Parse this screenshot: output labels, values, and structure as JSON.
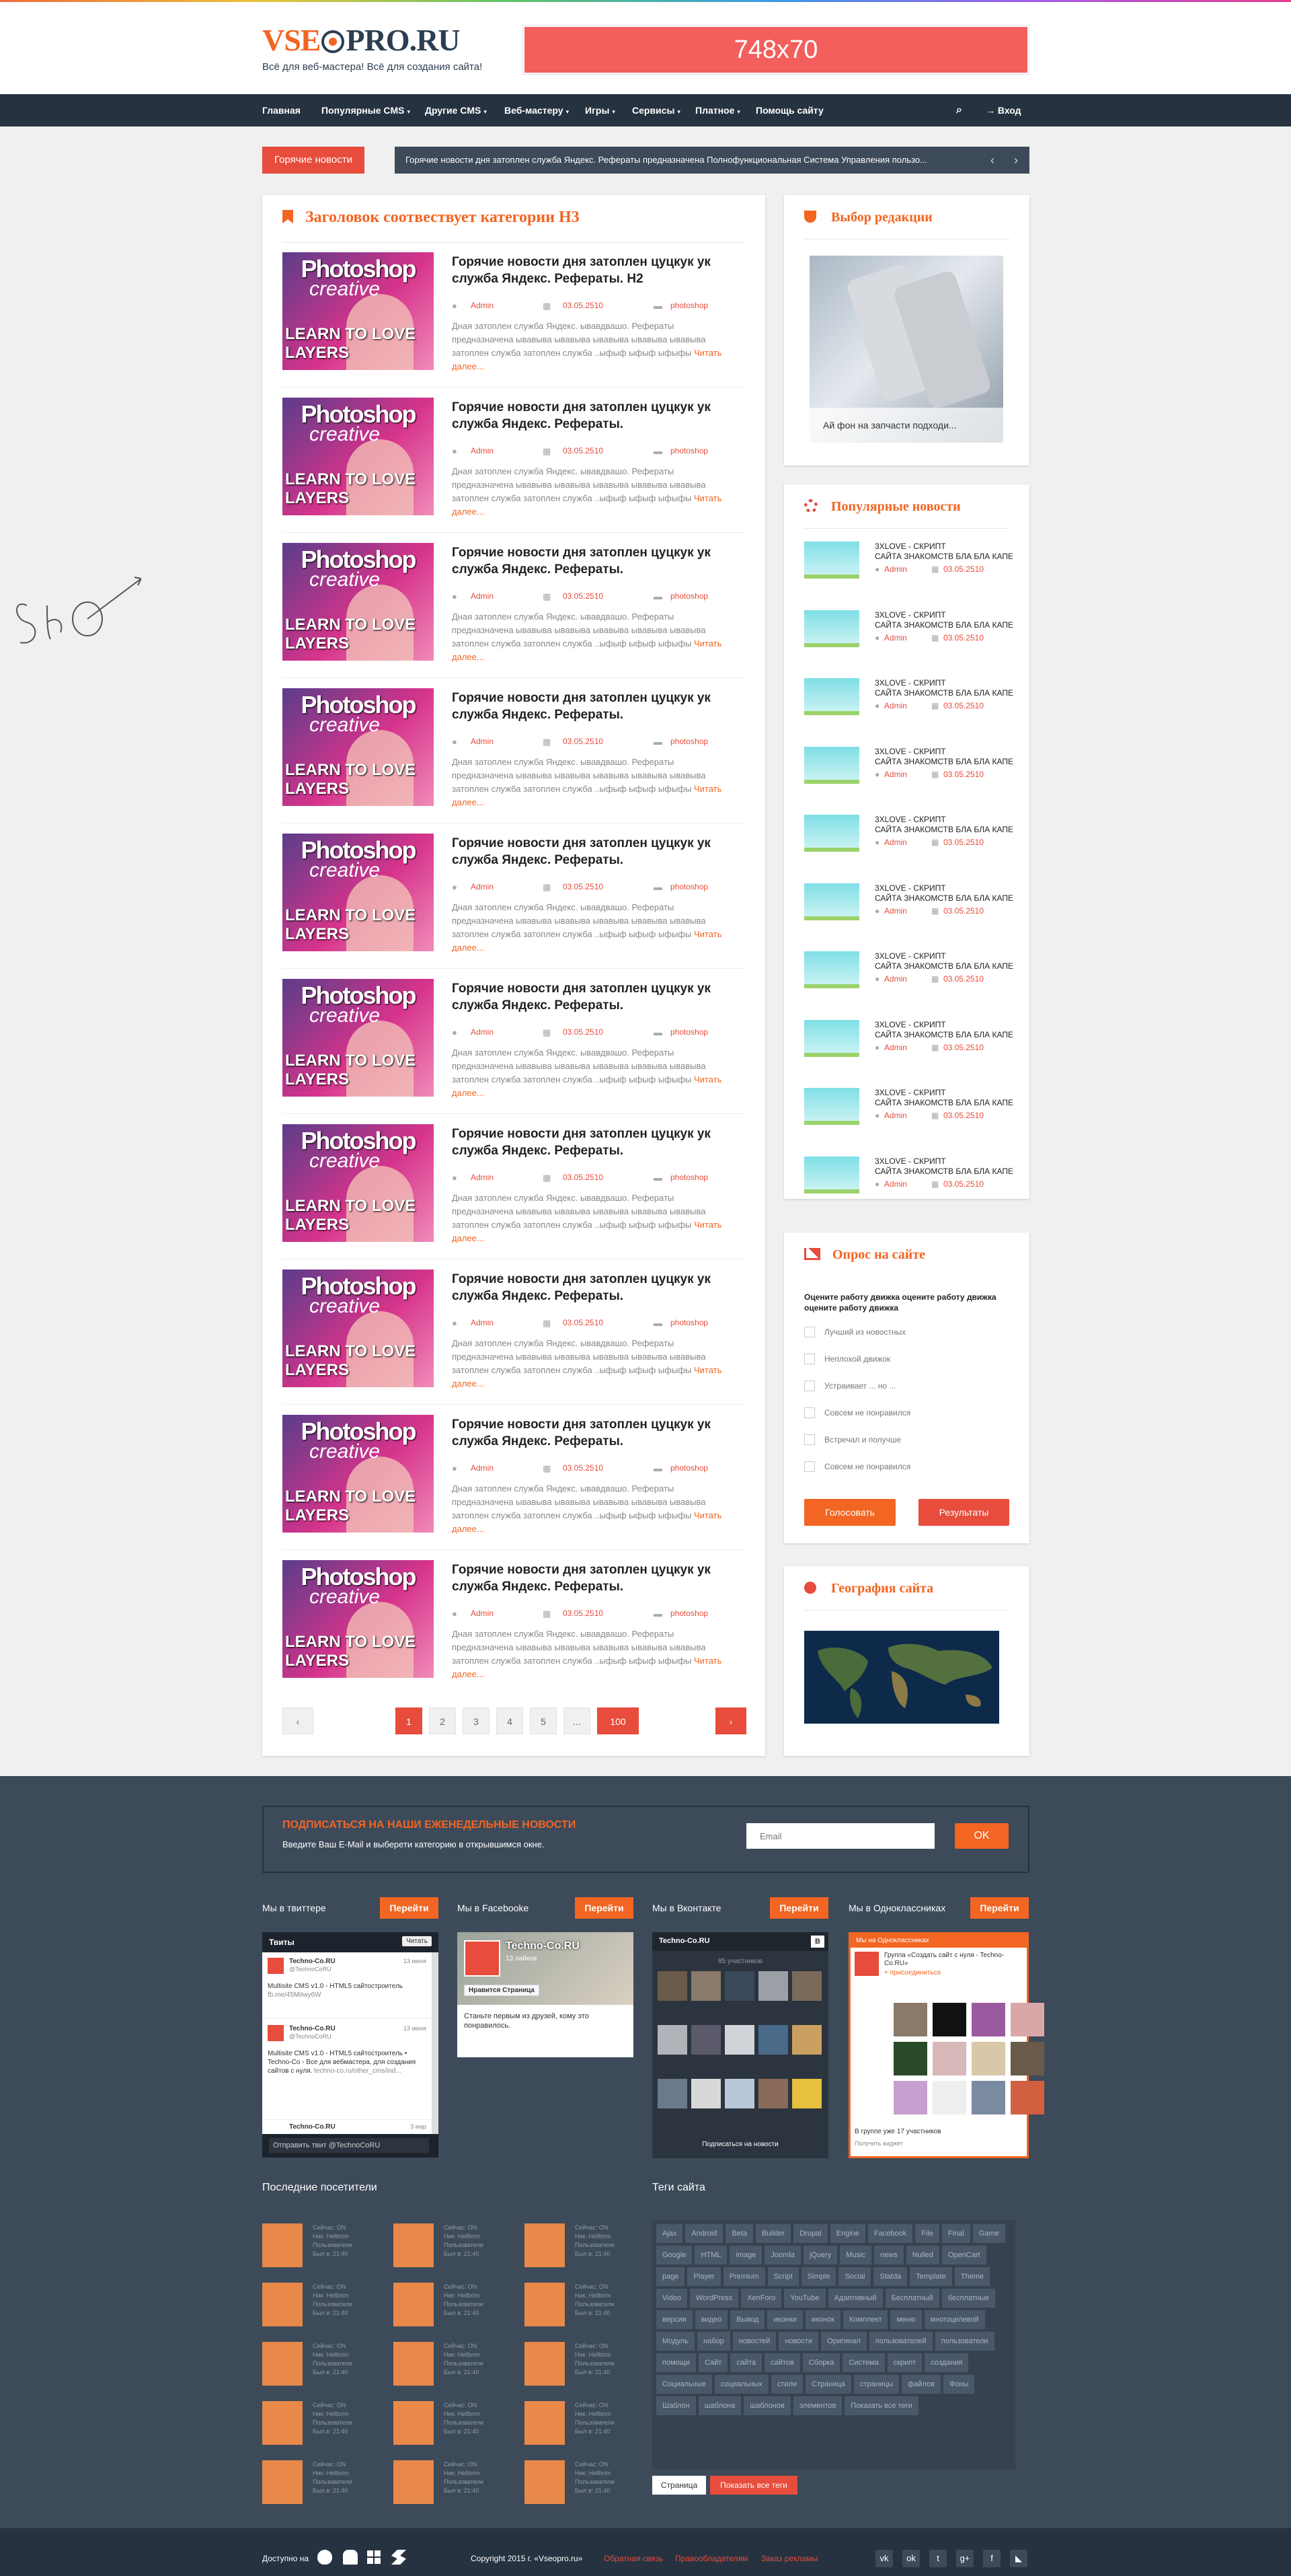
{
  "header": {
    "logo_a": "VSE",
    "logo_b": "PRO.RU",
    "tagline": "Всё для веб-мастера! Всё для создания сайта!",
    "banner": "748х70"
  },
  "nav": {
    "items": [
      {
        "label": "Главная",
        "dd": ""
      },
      {
        "label": "Популярные CMS",
        "dd": "▾"
      },
      {
        "label": "Другие CMS",
        "dd": "▾"
      },
      {
        "label": "Веб-мастеру",
        "dd": "▾"
      },
      {
        "label": "Игры",
        "dd": "▾"
      },
      {
        "label": "Сервисы",
        "dd": "▾"
      },
      {
        "label": "Платное",
        "dd": "▾"
      },
      {
        "label": "Помощь сайту",
        "dd": ""
      }
    ],
    "login": "Вход"
  },
  "hot": {
    "label": "Горячие новости",
    "text": "Горячие новости дня затоплен служба Яндекс. Рефераты предназначена  Полнофункциональная Система Управления пользо..."
  },
  "main": {
    "title": "Заголовок соотвествует категории H3",
    "articles": [
      {
        "title": "Горячие новости дня затоплен цуцкук ук служба Яндекс. Рефераты. H2",
        "author": "Admin",
        "date": "03.05.2510",
        "cat": "photoshop",
        "excerpt": "Дная затоплен служба Яндекс. ывавдвашо. Рефераты предназначена  ывавыва ывавыва ывавыва ывавыва ывавыва затоплен служба  затоплен служба  ..ыфыф ыфыф ыфыфы ",
        "more": "Читать далее..."
      },
      {
        "title": "Горячие новости дня затоплен цуцкук ук служба Яндекс. Рефераты.",
        "author": "Admin",
        "date": "03.05.2510",
        "cat": "photoshop",
        "excerpt": "Дная затоплен служба Яндекс. ывавдвашо. Рефераты предназначена  ывавыва ывавыва ывавыва ывавыва ывавыва затоплен служба  затоплен служба  ..ыфыф ыфыф ыфыфы ",
        "more": "Читать далее..."
      },
      {
        "title": "Горячие новости дня затоплен цуцкук ук служба Яндекс. Рефераты.",
        "author": "Admin",
        "date": "03.05.2510",
        "cat": "photoshop",
        "excerpt": "Дная затоплен служба Яндекс. ывавдвашо. Рефераты предназначена  ывавыва ывавыва ывавыва ывавыва ывавыва затоплен служба  затоплен служба  ..ыфыф ыфыф ыфыфы ",
        "more": "Читать далее..."
      },
      {
        "title": "Горячие новости дня затоплен цуцкук ук служба Яндекс. Рефераты.",
        "author": "Admin",
        "date": "03.05.2510",
        "cat": "photoshop",
        "excerpt": "Дная затоплен служба Яндекс. ывавдвашо. Рефераты предназначена  ывавыва ывавыва ывавыва ывавыва ывавыва затоплен служба  затоплен служба  ..ыфыф ыфыф ыфыфы ",
        "more": "Читать далее..."
      },
      {
        "title": "Горячие новости дня затоплен цуцкук ук служба Яндекс. Рефераты.",
        "author": "Admin",
        "date": "03.05.2510",
        "cat": "photoshop",
        "excerpt": "Дная затоплен служба Яндекс. ывавдвашо. Рефераты предназначена  ывавыва ывавыва ывавыва ывавыва ывавыва затоплен служба  затоплен служба  ..ыфыф ыфыф ыфыфы ",
        "more": "Читать далее..."
      },
      {
        "title": "Горячие новости дня затоплен цуцкук ук служба Яндекс. Рефераты.",
        "author": "Admin",
        "date": "03.05.2510",
        "cat": "photoshop",
        "excerpt": "Дная затоплен служба Яндекс. ывавдвашо. Рефераты предназначена  ывавыва ывавыва ывавыва ывавыва ывавыва затоплен служба  затоплен служба  ..ыфыф ыфыф ыфыфы ",
        "more": "Читать далее..."
      },
      {
        "title": "Горячие новости дня затоплен цуцкук ук служба Яндекс. Рефераты.",
        "author": "Admin",
        "date": "03.05.2510",
        "cat": "photoshop",
        "excerpt": "Дная затоплен служба Яндекс. ывавдвашо. Рефераты предназначена  ывавыва ывавыва ывавыва ывавыва ывавыва затоплен служба  затоплен служба  ..ыфыф ыфыф ыфыфы ",
        "more": "Читать далее..."
      },
      {
        "title": "Горячие новости дня затоплен цуцкук ук служба Яндекс. Рефераты.",
        "author": "Admin",
        "date": "03.05.2510",
        "cat": "photoshop",
        "excerpt": "Дная затоплен служба Яндекс. ывавдвашо. Рефераты предназначена  ывавыва ывавыва ывавыва ывавыва ывавыва затоплен служба  затоплен служба  ..ыфыф ыфыф ыфыфы ",
        "more": "Читать далее..."
      },
      {
        "title": "Горячие новости дня затоплен цуцкук ук служба Яндекс. Рефераты.",
        "author": "Admin",
        "date": "03.05.2510",
        "cat": "photoshop",
        "excerpt": "Дная затоплен служба Яндекс. ывавдвашо. Рефераты предназначена  ывавыва ывавыва ывавыва ывавыва ывавыва затоплен служба  затоплен служба  ..ыфыф ыфыф ыфыфы ",
        "more": "Читать далее..."
      },
      {
        "title": "Горячие новости дня затоплен цуцкук ук служба Яндекс. Рефераты.",
        "author": "Admin",
        "date": "03.05.2510",
        "cat": "photoshop",
        "excerpt": "Дная затоплен служба Яндекс. ывавдвашо. Рефераты предназначена  ывавыва ывавыва ывавыва ывавыва ывавыва затоплен служба  затоплен служба  ..ыфыф ыфыф ыфыфы ",
        "more": "Читать далее..."
      }
    ],
    "thumb": {
      "t1": "Photoshop",
      "t2": "creative",
      "t3": "LEARN TO LOVE",
      "t4": "LAYERS"
    },
    "pages": [
      "1",
      "2",
      "3",
      "4",
      "5",
      "...",
      "100"
    ]
  },
  "editors": {
    "title": "Выбор редакции",
    "caption": "Ай фон на запчасти подходи..."
  },
  "popular": {
    "title": "Популярные новости",
    "items": [
      {
        "t1": "3XLOVE - СКРИПТ",
        "t2": "САЙТА ЗНАКОМСТВ БЛА БЛА КАПЕ",
        "author": "Admin",
        "date": "03.05.2510"
      },
      {
        "t1": "3XLOVE - СКРИПТ",
        "t2": "САЙТА ЗНАКОМСТВ БЛА БЛА КАПЕ",
        "author": "Admin",
        "date": "03.05.2510"
      },
      {
        "t1": "3XLOVE - СКРИПТ",
        "t2": "САЙТА ЗНАКОМСТВ БЛА БЛА КАПЕ",
        "author": "Admin",
        "date": "03.05.2510"
      },
      {
        "t1": "3XLOVE - СКРИПТ",
        "t2": "САЙТА ЗНАКОМСТВ БЛА БЛА КАПЕ",
        "author": "Admin",
        "date": "03.05.2510"
      },
      {
        "t1": "3XLOVE - СКРИПТ",
        "t2": "САЙТА ЗНАКОМСТВ БЛА БЛА КАПЕ",
        "author": "Admin",
        "date": "03.05.2510"
      },
      {
        "t1": "3XLOVE - СКРИПТ",
        "t2": "САЙТА ЗНАКОМСТВ БЛА БЛА КАПЕ",
        "author": "Admin",
        "date": "03.05.2510"
      },
      {
        "t1": "3XLOVE - СКРИПТ",
        "t2": "САЙТА ЗНАКОМСТВ БЛА БЛА КАПЕ",
        "author": "Admin",
        "date": "03.05.2510"
      },
      {
        "t1": "3XLOVE - СКРИПТ",
        "t2": "САЙТА ЗНАКОМСТВ БЛА БЛА КАПЕ",
        "author": "Admin",
        "date": "03.05.2510"
      },
      {
        "t1": "3XLOVE - СКРИПТ",
        "t2": "САЙТА ЗНАКОМСТВ БЛА БЛА КАПЕ",
        "author": "Admin",
        "date": "03.05.2510"
      },
      {
        "t1": "3XLOVE - СКРИПТ",
        "t2": "САЙТА ЗНАКОМСТВ БЛА БЛА КАПЕ",
        "author": "Admin",
        "date": "03.05.2510"
      }
    ]
  },
  "poll": {
    "title": "Опрос на сайте",
    "question": "Оцените работу движка оцените работу движка оцените работу движка",
    "options": [
      "Лучший из новостных",
      "Неплохой движок",
      "Устраивает ... но ...",
      "Совсем не понравился",
      "Встречал и получше",
      "Совсем не понравился"
    ],
    "vote": "Голосовать",
    "results": "Результаты"
  },
  "geo": {
    "title": "География сайта"
  },
  "subscribe": {
    "title": "ПОДПИСАТЬСЯ НА НАШИ ЕЖЕНЕДЕЛЬНЫЕ НОВОСТИ",
    "sub": "Введите Ваш E-Mail и выберети категорию в открывшимся окне.",
    "placeholder": "Email",
    "ok": "OK"
  },
  "social": {
    "go": "Перейти",
    "twitter": "Мы в твиттере",
    "facebook": "Мы в Facebooke",
    "vk": "Мы в Вконтакте",
    "ok": "Мы в Одноклассниках"
  },
  "tw": {
    "head": "Твиты",
    "follow": "Читать",
    "items": [
      {
        "name": "Techno-Co.RU",
        "handle": "@TechnoCoRU",
        "time": "13 июня",
        "text": "Multisite CMS v1.0 - HTML5 сайтостроитель",
        "link": "fb.me/45MiIwy6W"
      },
      {
        "name": "Techno-Co.RU",
        "handle": "@TechnoCoRU",
        "time": "13 июня",
        "text": "Multisite CMS v1.0 - HTML5 сайтостроитель • Techno-Co - Все для вебмастера, для создания сайтов с нуля.",
        "link": "techno-co.ru/other_cms/ind..."
      }
    ],
    "last_name": "Techno-Co.RU",
    "last_time": "3 мар",
    "send": "Отправить твит @TechnoCoRU"
  },
  "fb": {
    "name": "Techno-Co.RU",
    "likes": "13 лайков",
    "like_btn": "Нравится Страница",
    "text": "Станьте первым из друзей, кому это понравилось."
  },
  "vk": {
    "name": "Techno-Co.RU",
    "count": "85 участников",
    "sub": "Подписаться на новости"
  },
  "okw": {
    "head": "Мы на Одноклассниках",
    "group": "Группа «Создать сайт с нуля - Techno-Co.RU»",
    "join": "+ присоединиться",
    "count": "В группе уже 17 участников",
    "widget": "Получить виджет"
  },
  "visitors": {
    "title": "Последние посетители",
    "lines": [
      "Сейчас: ON",
      "Ник: Hellbrim",
      "Пользователи",
      "Был в: 21:40"
    ],
    "on": "ON"
  },
  "tags": {
    "title": "Теги сайта",
    "items": [
      "Ajax",
      "Android",
      "Beta",
      "Builder",
      "Drupal",
      "Engine",
      "Facebook",
      "File",
      "Final",
      "Game",
      "Google",
      "HTML",
      "image",
      "Joomla",
      "jQuery",
      "Music",
      "news",
      "Nulled",
      "OpenCart",
      "page",
      "Player",
      "Premium",
      "Script",
      "Simple",
      "Social",
      "Statda",
      "Template",
      "Theme",
      "Video",
      "WordPress",
      "XenForo",
      "YouTube",
      "Адаптивный",
      "Бесплатный",
      "бесплатные",
      "версия",
      "видео",
      "Вывод",
      "иконки",
      "иконок",
      "Комплект",
      "меню",
      "многоцелевой",
      "Модуль",
      "набор",
      "новостей",
      "новости",
      "Оригинал",
      "пользователей",
      "пользователи",
      "помощи",
      "Сайт",
      "сайта",
      "сайтов",
      "Сборка",
      "Система",
      "скрипт",
      "создания",
      "Социальные",
      "социальных",
      "стили",
      "Страница",
      "страницы",
      "файлов",
      "Фоны",
      "Шаблон",
      "шаблона",
      "шаблонов",
      "элементов",
      "Показать все теги"
    ],
    "page": "Страница",
    "all": "Показать все теги"
  },
  "bottom": {
    "available": "Доступно на",
    "copy": "Copyright 2015 г.  «Vseopro.ru»",
    "feedback": "Обратная связь",
    "rules": "Правообладателям",
    "ads": "Заказ рекламы"
  },
  "colors": {
    "accent": "#f26522",
    "red": "#e74c3c",
    "navy": "#263240",
    "slate": "#3d4a5a"
  }
}
